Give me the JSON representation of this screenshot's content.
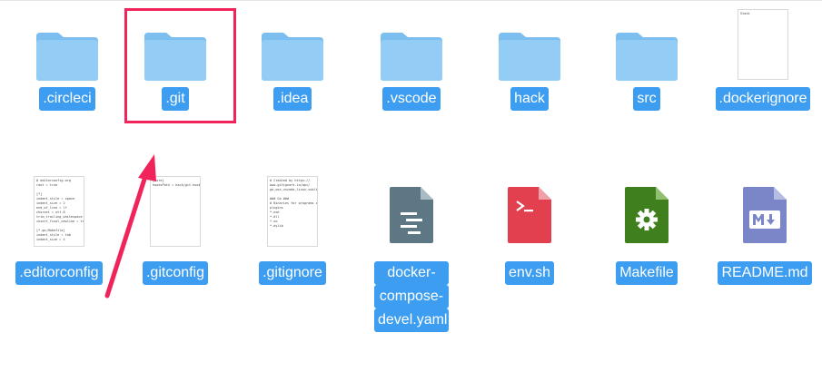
{
  "files": {
    "row1": [
      {
        "name": ".circleci",
        "kind": "folder",
        "icon": "folder-icon"
      },
      {
        "name": ".git",
        "kind": "folder",
        "icon": "folder-icon"
      },
      {
        "name": ".idea",
        "kind": "folder",
        "icon": "folder-icon"
      },
      {
        "name": ".vscode",
        "kind": "folder",
        "icon": "folder-icon"
      },
      {
        "name": "hack",
        "kind": "folder",
        "icon": "folder-icon"
      },
      {
        "name": "src",
        "kind": "folder",
        "icon": "folder-icon"
      },
      {
        "name": ".dockerignore",
        "kind": "document",
        "preview": "Stack"
      }
    ],
    "row2": [
      {
        "name": ".editorconfig",
        "kind": "document",
        "preview": "# editorconfig.org\nroot = true\n\n[*]\nindent_style = space\nindent_size = 2\nend_of_line = lf\ncharset = utf-8\ntrim_trailing_whitespace = true\ninsert_final_newline = true\n\n[*.go,Makefile]\nindent_style = tab\nindent_size = 4"
      },
      {
        "name": ".gitconfig",
        "kind": "document",
        "preview": "[core]\nhooksPath = hack/git-hooks/"
      },
      {
        "name": ".gitignore",
        "kind": "document",
        "preview": "# Created by https://\nwww.gitignore.io/api/\ngo,osx,vscode,linux,sublimetext\n\n### Go ###\n# Binaries for programs and\nplugins\n*.exe\n*.dll\n*.so\n*.dylib"
      },
      {
        "name_lines": [
          "docker-",
          "compose-",
          "devel.yaml"
        ],
        "kind": "yaml",
        "icon": "yaml-file-icon"
      },
      {
        "name": "env.sh",
        "kind": "script",
        "icon": "terminal-file-icon"
      },
      {
        "name": "Makefile",
        "kind": "makefile",
        "icon": "gear-file-icon"
      },
      {
        "name": "README.md",
        "kind": "markdown",
        "icon": "markdown-file-icon"
      }
    ]
  },
  "selection_highlight": {
    "target": ".git",
    "color": "#f0245a"
  },
  "colors": {
    "label_bg": "#3d9df0",
    "folder": "#8ec9f5",
    "yaml_icon": "#5e7785",
    "script_icon": "#e2404f",
    "makefile_icon": "#3f7f1d",
    "markdown_icon": "#7a86c7",
    "annotation": "#f0245a"
  }
}
